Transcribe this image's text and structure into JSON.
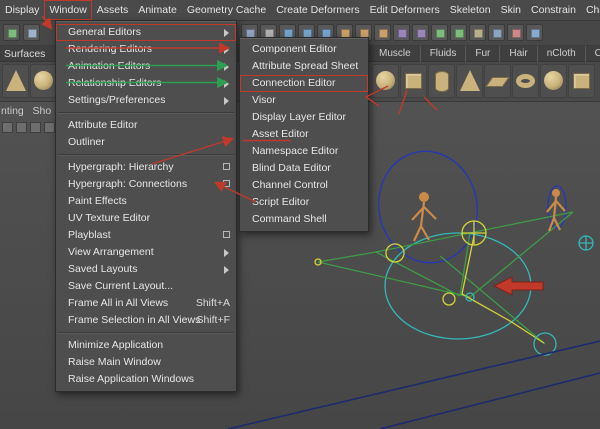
{
  "colors": {
    "annotation_red": "#c0392b",
    "annotation_green": "#2e9e52",
    "wire_blue": "#2437b8",
    "wire_cyan": "#35b8b8",
    "wire_green": "#3f9b46",
    "wire_yellow": "#d4d337",
    "wire_navy": "#1c2a6e",
    "figure_tan": "#c98a4a",
    "shelf_icon_tan": "#c9b27c"
  },
  "menubar": {
    "items": [
      {
        "label": "Display"
      },
      {
        "label": "Window",
        "annotated": true
      },
      {
        "label": "Assets"
      },
      {
        "label": "Animate"
      },
      {
        "label": "Geometry Cache"
      },
      {
        "label": "Create Deformers"
      },
      {
        "label": "Edit Deformers"
      },
      {
        "label": "Skeleton"
      },
      {
        "label": "Skin"
      },
      {
        "label": "Constrain"
      },
      {
        "label": "Character"
      }
    ]
  },
  "window_menu": {
    "items": [
      {
        "label": "General Editors",
        "submenu": true,
        "annotated": true
      },
      {
        "label": "Rendering Editors",
        "submenu": true
      },
      {
        "label": "Animation Editors",
        "submenu": true
      },
      {
        "label": "Relationship Editors",
        "submenu": true
      },
      {
        "label": "Settings/Preferences",
        "submenu": true
      },
      {
        "separator": true
      },
      {
        "label": "Attribute Editor"
      },
      {
        "label": "Outliner"
      },
      {
        "separator": true
      },
      {
        "label": "Hypergraph: Hierarchy",
        "optionbox": true
      },
      {
        "label": "Hypergraph: Connections",
        "optionbox": true
      },
      {
        "label": "Paint Effects"
      },
      {
        "label": "UV Texture Editor"
      },
      {
        "label": "Playblast",
        "optionbox": true
      },
      {
        "label": "View Arrangement",
        "submenu": true
      },
      {
        "label": "Saved Layouts",
        "submenu": true
      },
      {
        "label": "Save Current Layout..."
      },
      {
        "label": "Frame All in All Views",
        "shortcut": "Shift+A"
      },
      {
        "label": "Frame Selection in All Views",
        "shortcut": "Shift+F"
      },
      {
        "separator": true
      },
      {
        "label": "Minimize Application"
      },
      {
        "label": "Raise Main Window"
      },
      {
        "label": "Raise Application Windows"
      }
    ]
  },
  "general_editors_submenu": {
    "items": [
      {
        "label": "Component Editor"
      },
      {
        "label": "Attribute Spread Sheet"
      },
      {
        "label": "Connection Editor",
        "annotated": true
      },
      {
        "label": "Visor"
      },
      {
        "label": "Display Layer Editor"
      },
      {
        "label": "Asset Editor"
      },
      {
        "label": "Namespace Editor"
      },
      {
        "label": "Blind Data Editor"
      },
      {
        "label": "Channel Control"
      },
      {
        "label": "Script Editor"
      },
      {
        "label": "Command Shell"
      }
    ]
  },
  "shelf": {
    "left_label": "Surfaces",
    "tabs": [
      "Muscle",
      "Fluids",
      "Fur",
      "Hair",
      "nCloth",
      "C"
    ],
    "icon_shapes_left": [
      "cone",
      "sphere"
    ],
    "icon_shapes_right": [
      "sphere",
      "cube",
      "cylinder",
      "cone",
      "plane",
      "torus",
      "sphere",
      "cube"
    ]
  },
  "toolbar": {
    "left_icon_colors": [
      "#7fba7f",
      "#9fb2c8"
    ],
    "right_icon_colors": [
      "#8fa3bf",
      "#b0b0b0",
      "#76a3c9",
      "#76a3c9",
      "#76a3c9",
      "#c9a06a",
      "#c9a06a",
      "#c9a06a",
      "#9a86b8",
      "#9a86b8",
      "#7fba7f",
      "#7fba7f",
      "#b8b08a",
      "#8fa3bf",
      "#cc8888",
      "#88aacc"
    ]
  },
  "viewport": {
    "panel_text_partial": "nting   Sho",
    "panel_icon_colors": [
      "#6e6e6e",
      "#6e6e6e",
      "#6e6e6e",
      "#6e6e6e",
      "#6e6e6e"
    ]
  }
}
